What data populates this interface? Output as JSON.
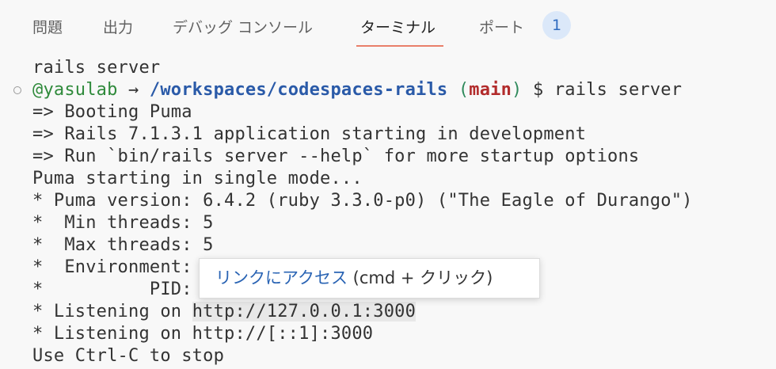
{
  "tabs": [
    {
      "label": "問題"
    },
    {
      "label": "出力"
    },
    {
      "label": "デバッグ コンソール"
    },
    {
      "label": "ターミナル",
      "active": true
    },
    {
      "label": "ポート"
    }
  ],
  "ports_badge": "1",
  "terminal": {
    "lines": [
      "rails server",
      "",
      "=> Booting Puma",
      "=> Rails 7.1.3.1 application starting in development",
      "=> Run `bin/rails server --help` for more startup options",
      "Puma starting in single mode...",
      "* Puma version: 6.4.2 (ruby 3.3.0-p0) (\"The Eagle of Durango\")",
      "*  Min threads: 5",
      "*  Max threads: 5",
      "*  Environment:",
      "*          PID:",
      "* Listening on ",
      "* Listening on http://[::1]:3000",
      "Use Ctrl-C to stop"
    ],
    "prompt": {
      "user": "@yasulab",
      "arrow": " → ",
      "path": "/workspaces/codespaces-rails",
      "paren_open": " (",
      "branch": "main",
      "paren_close": ")",
      "tail": " $ rails server"
    },
    "link_text": "http://127.0.0.1:3000"
  },
  "tooltip": {
    "link_label": "リンクにアクセス",
    "hint": " (cmd + クリック)"
  },
  "colors": {
    "user": "#2f8a3b",
    "path": "#2a5aa8",
    "branch": "#b22b2b",
    "tab_underline": "#e97f6a",
    "badge_bg": "#dbe8f9"
  }
}
